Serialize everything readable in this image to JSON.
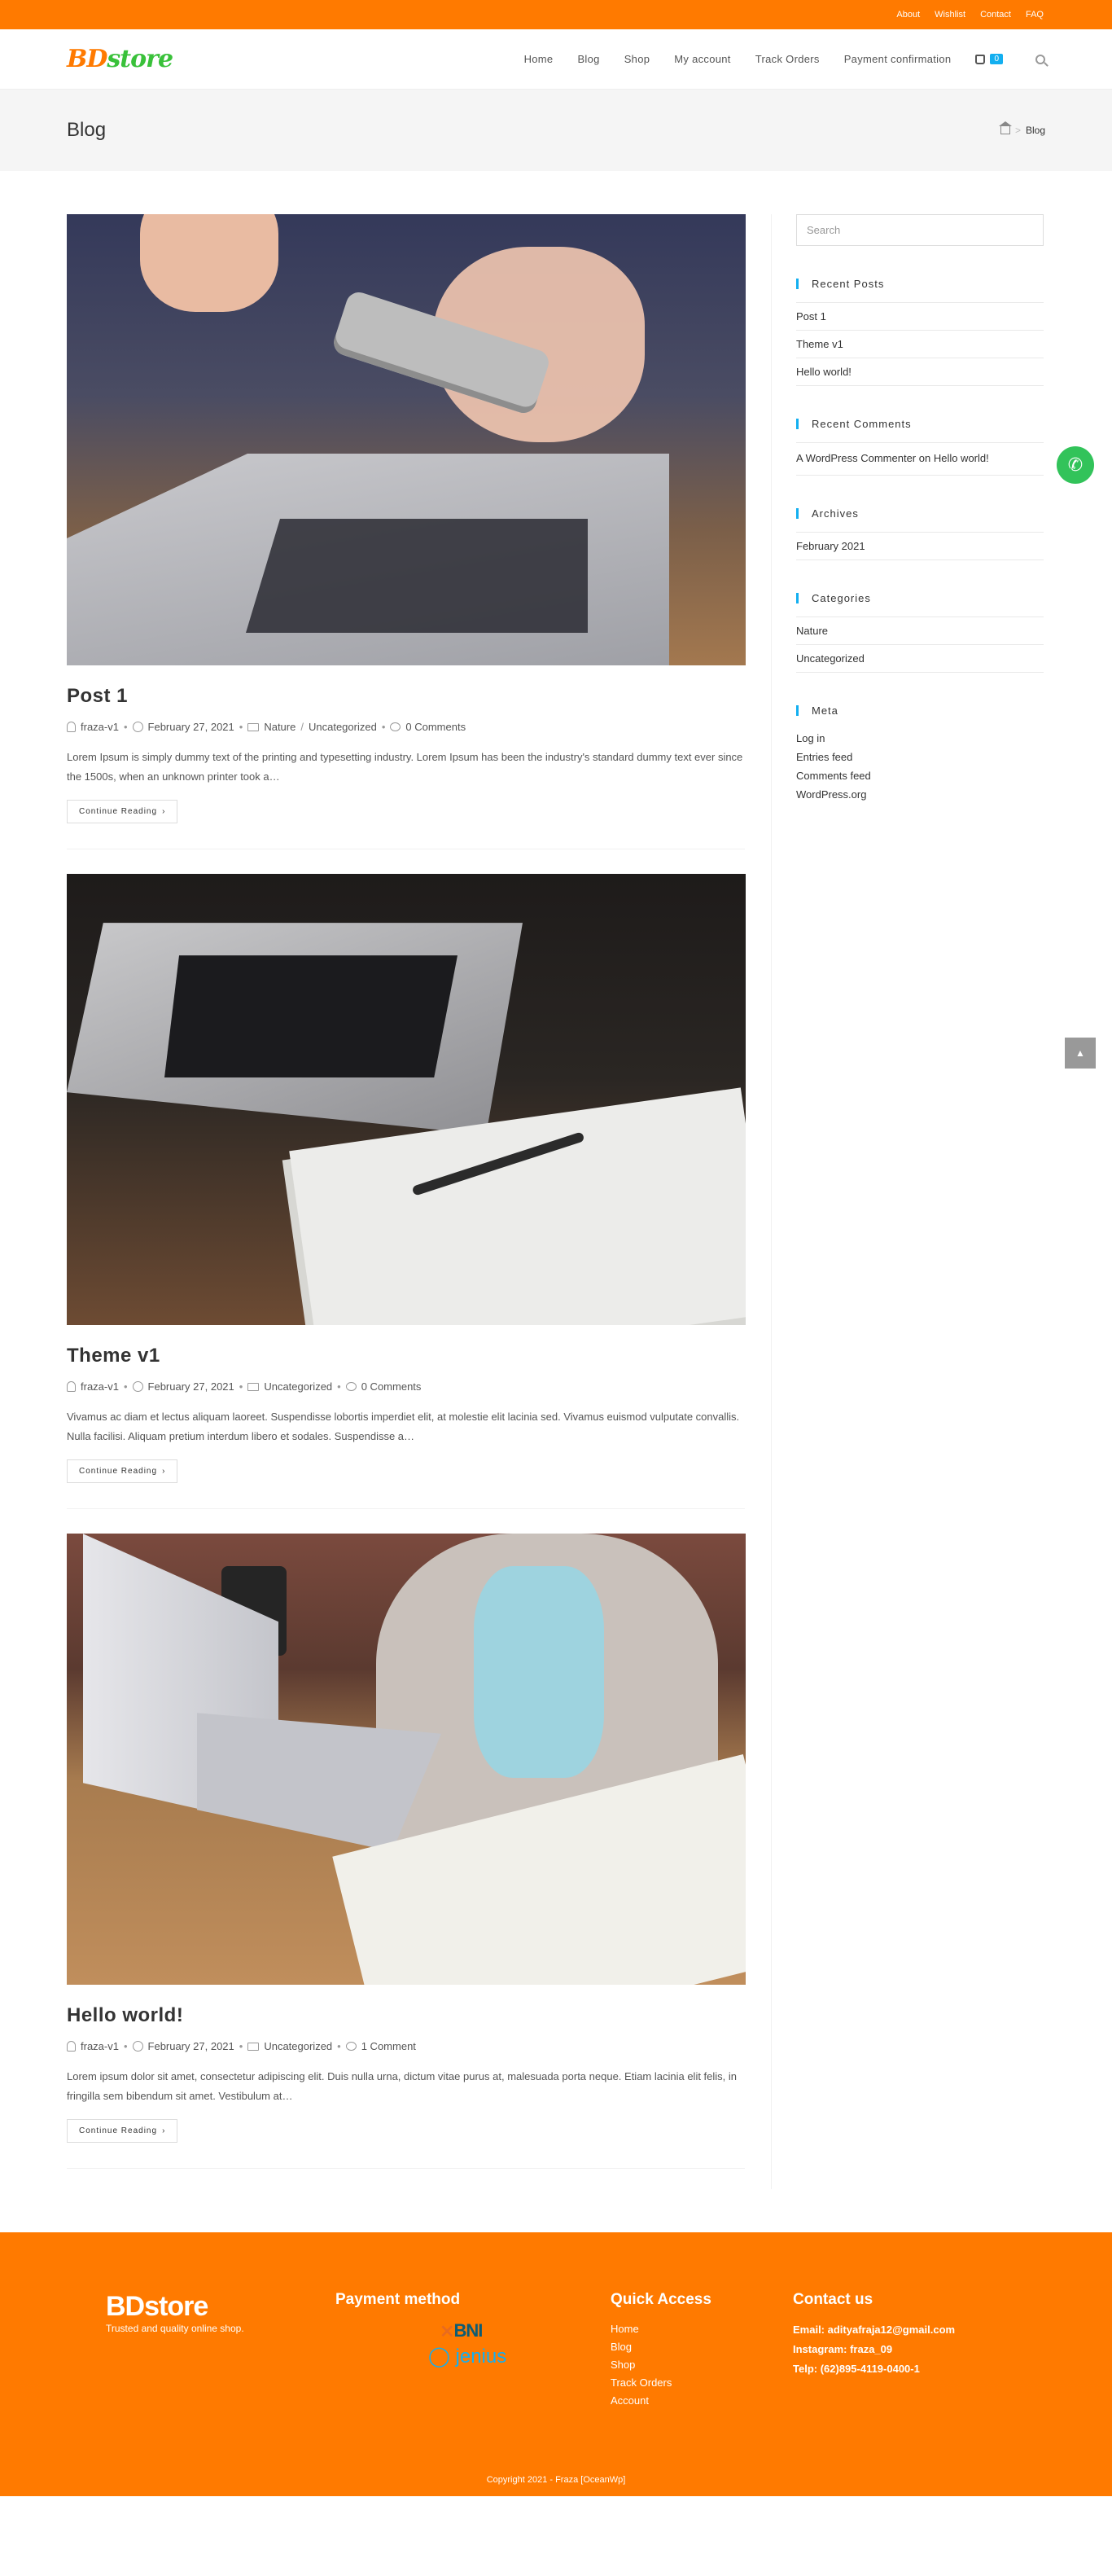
{
  "topbar": {
    "links": [
      "About",
      "Wishlist",
      "Contact",
      "FAQ"
    ]
  },
  "header": {
    "logo_part1": "BD",
    "logo_part2": "store",
    "nav": [
      "Home",
      "Blog",
      "Shop",
      "My account",
      "Track Orders",
      "Payment confirmation"
    ],
    "cart_count": "0"
  },
  "titlebar": {
    "title": "Blog",
    "breadcrumb_current": "Blog",
    "breadcrumb_sep": ">"
  },
  "posts": [
    {
      "title": "Post 1",
      "author": "fraza-v1",
      "date": "February 27, 2021",
      "categories": [
        "Nature",
        "Uncategorized"
      ],
      "comments": "0 Comments",
      "excerpt": "Lorem Ipsum is simply dummy text of the printing and typesetting industry. Lorem Ipsum has been the industry's standard dummy text ever since the 1500s, when an unknown printer took a…",
      "more": "Continue Reading"
    },
    {
      "title": "Theme v1",
      "author": "fraza-v1",
      "date": "February 27, 2021",
      "categories": [
        "Uncategorized"
      ],
      "comments": "0 Comments",
      "excerpt": "Vivamus ac diam et lectus aliquam laoreet. Suspendisse lobortis imperdiet elit, at molestie elit lacinia sed. Vivamus euismod vulputate convallis. Nulla facilisi. Aliquam pretium interdum libero et sodales. Suspendisse a…",
      "more": "Continue Reading"
    },
    {
      "title": "Hello world!",
      "author": "fraza-v1",
      "date": "February 27, 2021",
      "categories": [
        "Uncategorized"
      ],
      "comments": "1 Comment",
      "excerpt": "Lorem ipsum dolor sit amet, consectetur adipiscing elit. Duis nulla urna, dictum vitae purus at, malesuada porta neque. Etiam lacinia elit felis, in fringilla sem bibendum sit amet. Vestibulum at…",
      "more": "Continue Reading"
    }
  ],
  "sidebar": {
    "search_placeholder": "Search",
    "recent_posts": {
      "title": "Recent Posts",
      "items": [
        "Post 1",
        "Theme v1",
        "Hello world!"
      ]
    },
    "recent_comments": {
      "title": "Recent Comments",
      "item": "A WordPress Commenter on Hello world!"
    },
    "archives": {
      "title": "Archives",
      "items": [
        "February 2021"
      ]
    },
    "categories": {
      "title": "Categories",
      "items": [
        "Nature",
        "Uncategorized"
      ]
    },
    "meta": {
      "title": "Meta",
      "items": [
        "Log in",
        "Entries feed",
        "Comments feed",
        "WordPress.org"
      ]
    }
  },
  "footer": {
    "logo": "BDstore",
    "tagline": "Trusted and quality online shop.",
    "payment_title": "Payment method",
    "bni_mark": "⨯",
    "bni": "BNI",
    "jenius": "jenius",
    "quick_title": "Quick Access",
    "quick_links": [
      "Home",
      "Blog",
      "Shop",
      "Track Orders",
      "Account"
    ],
    "contact_title": "Contact us",
    "email": "Email: adityafraja12@gmail.com",
    "instagram": "Instagram: fraza_09",
    "phone": "Telp: (62)895-4119-0400-1",
    "copyright": "Copyright 2021 - Fraza [OceanWp]"
  },
  "colors": {
    "brand_orange": "#ff7a00",
    "logo_green": "#39c13a",
    "accent_blue": "#13aff0",
    "whatsapp_green": "#32c35a"
  }
}
